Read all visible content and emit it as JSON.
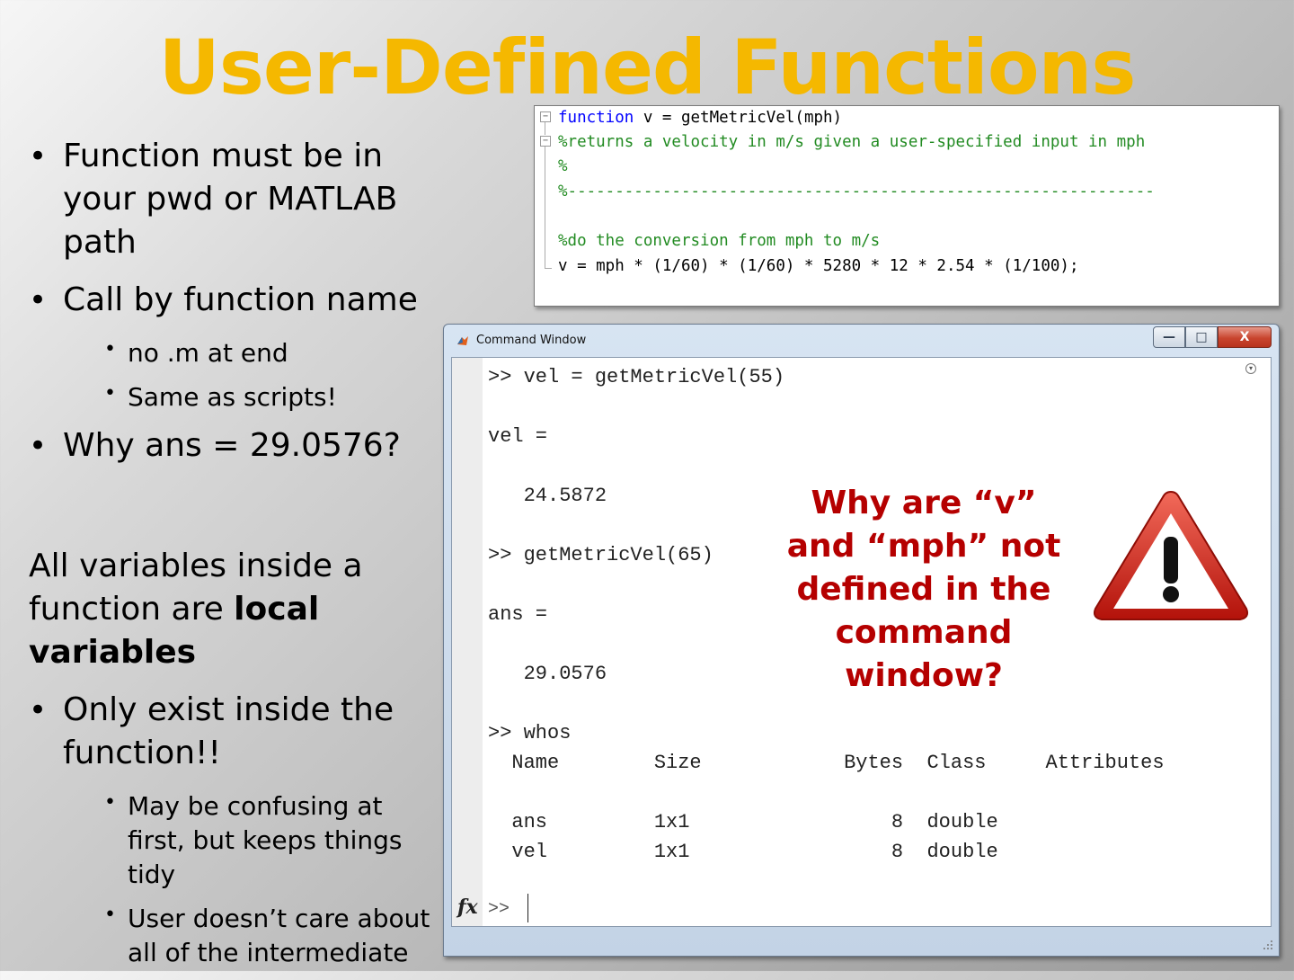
{
  "slide": {
    "title": "User-Defined Functions"
  },
  "bullets": {
    "b1": "Function must be in your pwd or MATLAB path",
    "b2": "Call by function name",
    "b2_sub1": "no .m at end",
    "b2_sub2": "Same as scripts!",
    "b3": "Why ans = 29.0576?",
    "para_prefix": "All variables inside a function are ",
    "para_bold": "local variables",
    "b4": "Only exist inside the function!!",
    "b4_sub1": "May be confusing at first, but keeps things tidy",
    "b4_sub2": "User doesn’t care about all of the intermediate"
  },
  "bullet_glyph": "•",
  "sub_bullet_glyph": "•",
  "editor": {
    "line1_kw": "function",
    "line1_rest": " v = getMetricVel(mph)",
    "line2": "%returns a velocity in m/s given a user-specified input in mph",
    "line3": "%",
    "line4": "%--------------------------------------------------------------",
    "line5": "%do the conversion from mph to m/s",
    "line6": "v = mph * (1/60) * (1/60) * 5280 * 12 * 2.54 * (1/100);"
  },
  "command_window": {
    "title": "Command Window",
    "lines": {
      "l1": ">> vel = getMetricVel(55)",
      "l2": "vel =",
      "l3": "   24.5872",
      "l4": ">> getMetricVel(65)",
      "l5": "ans =",
      "l6": "   29.0576",
      "l7": ">> whos",
      "l8": "  Name        Size            Bytes  Class     Attributes",
      "l9": "  ans         1x1                 8  double",
      "l10": "  vel         1x1                 8  double"
    },
    "prompt": ">>",
    "fx_label": "fx",
    "minimize": "—",
    "maximize": "□",
    "close": "X",
    "menu_arrow": "▾"
  },
  "callout": {
    "text": "Why are “v” and “mph” not defined in the command window?"
  },
  "colors": {
    "title": "#f5b800",
    "callout": "#b50000",
    "keyword": "#0000ff",
    "comment": "#228b22"
  },
  "icons": {
    "warning": "warning-triangle-icon",
    "matlab_logo": "matlab-logo-icon"
  }
}
